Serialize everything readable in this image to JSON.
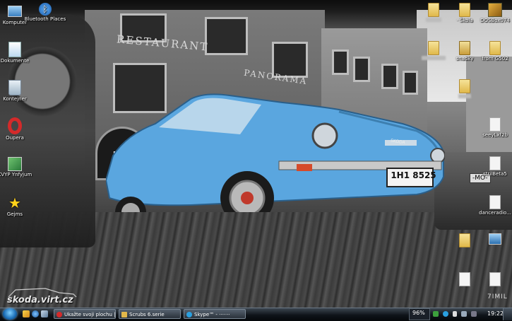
{
  "desktop_icons_left": [
    {
      "label": "Komputer",
      "icon": "computer-icon"
    },
    {
      "label": "Dokumente",
      "icon": "documents-icon"
    },
    {
      "label": "Kontejner",
      "icon": "recycle-bin-icon"
    },
    {
      "label": "Oupera",
      "icon": "opera-icon"
    },
    {
      "label": "KVYP Ynfyjum",
      "icon": "app-icon"
    },
    {
      "label": "Gejms",
      "icon": "star-icon"
    }
  ],
  "desktop_icon_bluetooth": {
    "label": "Bluetooth Places",
    "icon": "bluetooth-icon"
  },
  "desktop_icons_right": [
    {
      "label": "",
      "icon": "folder-icon"
    },
    {
      "label": "· Škola",
      "icon": "folder-icon"
    },
    {
      "label": "DOSBox074",
      "icon": "dosbox-icon"
    },
    {
      "label": "",
      "icon": "folder-icon"
    },
    {
      "label": "snadky",
      "icon": "folder-icon"
    },
    {
      "label": "from G502",
      "icon": "folder-icon"
    },
    {
      "label": "",
      "icon": "folder-icon"
    },
    {
      "label": "seeyLxf2b",
      "icon": "file-icon"
    },
    {
      "label": "strilBeta5",
      "icon": "file-icon"
    },
    {
      "label": "danceradio...",
      "icon": "file-icon"
    },
    {
      "label": "",
      "icon": "folder-icon"
    },
    {
      "label": "",
      "icon": "computer-icon"
    },
    {
      "label": "",
      "icon": "file-icon"
    },
    {
      "label": "",
      "icon": "file-icon"
    }
  ],
  "wallpaper": {
    "sign_restaurant": "RESTAURANT",
    "sign_panorama": "PANORAMA",
    "shop_text": "kade",
    "license_plate": "1H1 8525",
    "car_badge": "SKODA",
    "right_plate": "-MO-",
    "watermark": "skoda.virt.cz",
    "corner_logo": "7IMIL"
  },
  "taskbar": {
    "tasks": [
      {
        "label": "Ukažte svoji plochu | ...",
        "icon": "opera-icon",
        "color": "#d42a2a"
      },
      {
        "label": "Scrubs 6.serie",
        "icon": "folder-icon",
        "color": "#e2b84a"
      },
      {
        "label": "Skype™ - ·······",
        "icon": "skype-icon",
        "color": "#2aa0e0"
      }
    ],
    "tray": {
      "battery": "96%",
      "time": "19:22"
    }
  }
}
